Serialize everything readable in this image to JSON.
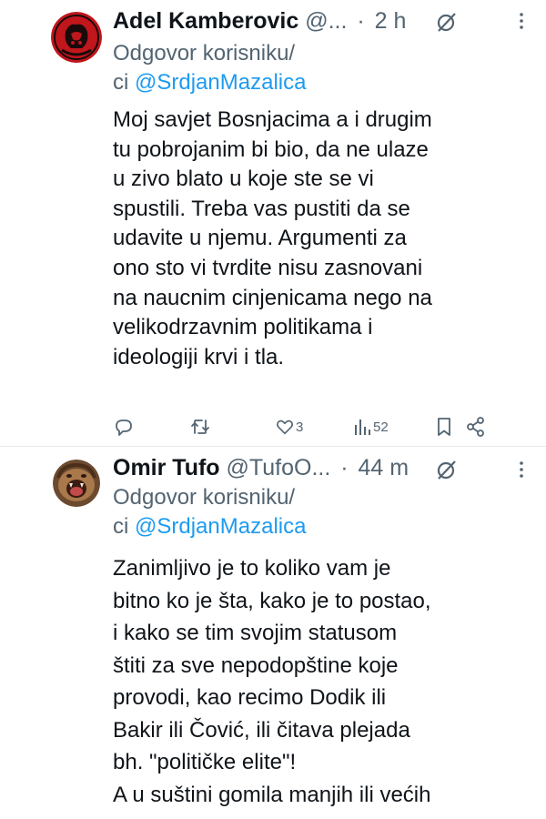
{
  "tweets": [
    {
      "author_name": "Adel Kamberovic",
      "handle": "@...",
      "separator": "·",
      "time": "2 h",
      "reply_to_label": "Odgovor korisniku/",
      "reply_to_prefix": "ci",
      "reply_to_mention": "@SrdjanMazalica",
      "body_lines": [
        "Moj savjet Bosnjacima a i drugim",
        "tu pobrojanim bi bio, da ne ulaze",
        "u zivo blato u koje ste se vi",
        "spustili. Treba vas pustiti da se",
        "udavite u njemu. Argumenti za",
        "ono sto vi tvrdite nisu zasnovani",
        "na naucnim cinjenicama nego na",
        "velikodrzavnim politikama i",
        "ideologiji krvi i tla."
      ],
      "likes": "3",
      "views": "52",
      "icons": {
        "reply": "comment-icon",
        "retweet": "retweet-icon",
        "like": "heart-icon",
        "views": "views-bar-icon",
        "bookmark": "bookmark-icon",
        "share": "share-icon",
        "grok": "grok-slash-icon",
        "more": "more-vertical-icon"
      }
    },
    {
      "author_name": "Omir Tufo",
      "handle": "@TufoO...",
      "separator": "·",
      "time": "44 m",
      "reply_to_label": "Odgovor korisniku/",
      "reply_to_prefix": "ci",
      "reply_to_mention": "@SrdjanMazalica",
      "body_lines": [
        "Zanimljivo je to koliko vam je",
        "bitno ko je šta, kako je to postao,",
        "i kako se tim svojim statusom",
        "štiti za sve nepodopštine koje",
        "provodi, kao recimo Dodik ili",
        "Bakir ili Čović, ili čitava plejada",
        "bh. \"političke elite\"!",
        "A u suštini gomila manjih ili većih"
      ]
    }
  ],
  "colors": {
    "text": "#0f1419",
    "secondary": "#536471",
    "mention": "#1d9bf0",
    "divider": "#e6e9ec"
  }
}
